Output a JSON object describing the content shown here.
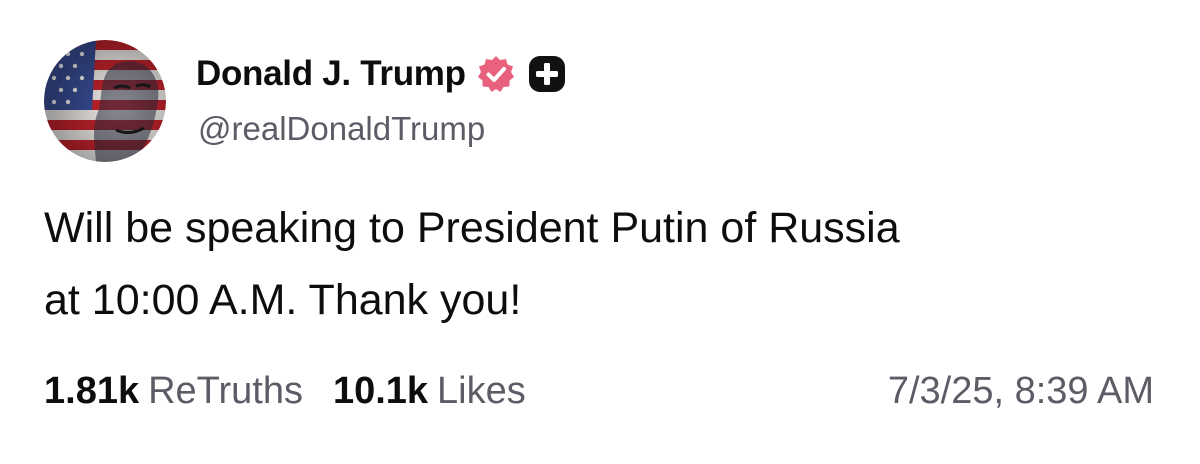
{
  "author": {
    "display_name": "Donald J. Trump",
    "handle": "@realDonaldTrump",
    "avatar_icon": "avatar-flag-portrait",
    "verified_icon": "verified-badge-icon",
    "plus_icon": "plus-badge-icon"
  },
  "post": {
    "text": "Will be speaking to President Putin of Russia\nat 10:00 A.M. Thank you!"
  },
  "stats": {
    "retruths_count": "1.81k",
    "retruths_label": "ReTruths",
    "likes_count": "10.1k",
    "likes_label": "Likes"
  },
  "timestamp": "7/3/25, 8:39 AM",
  "colors": {
    "verified_badge": "#e8627e",
    "plus_badge": "#111111",
    "secondary_text": "#5c5c66",
    "primary_text": "#0d0d0d"
  }
}
